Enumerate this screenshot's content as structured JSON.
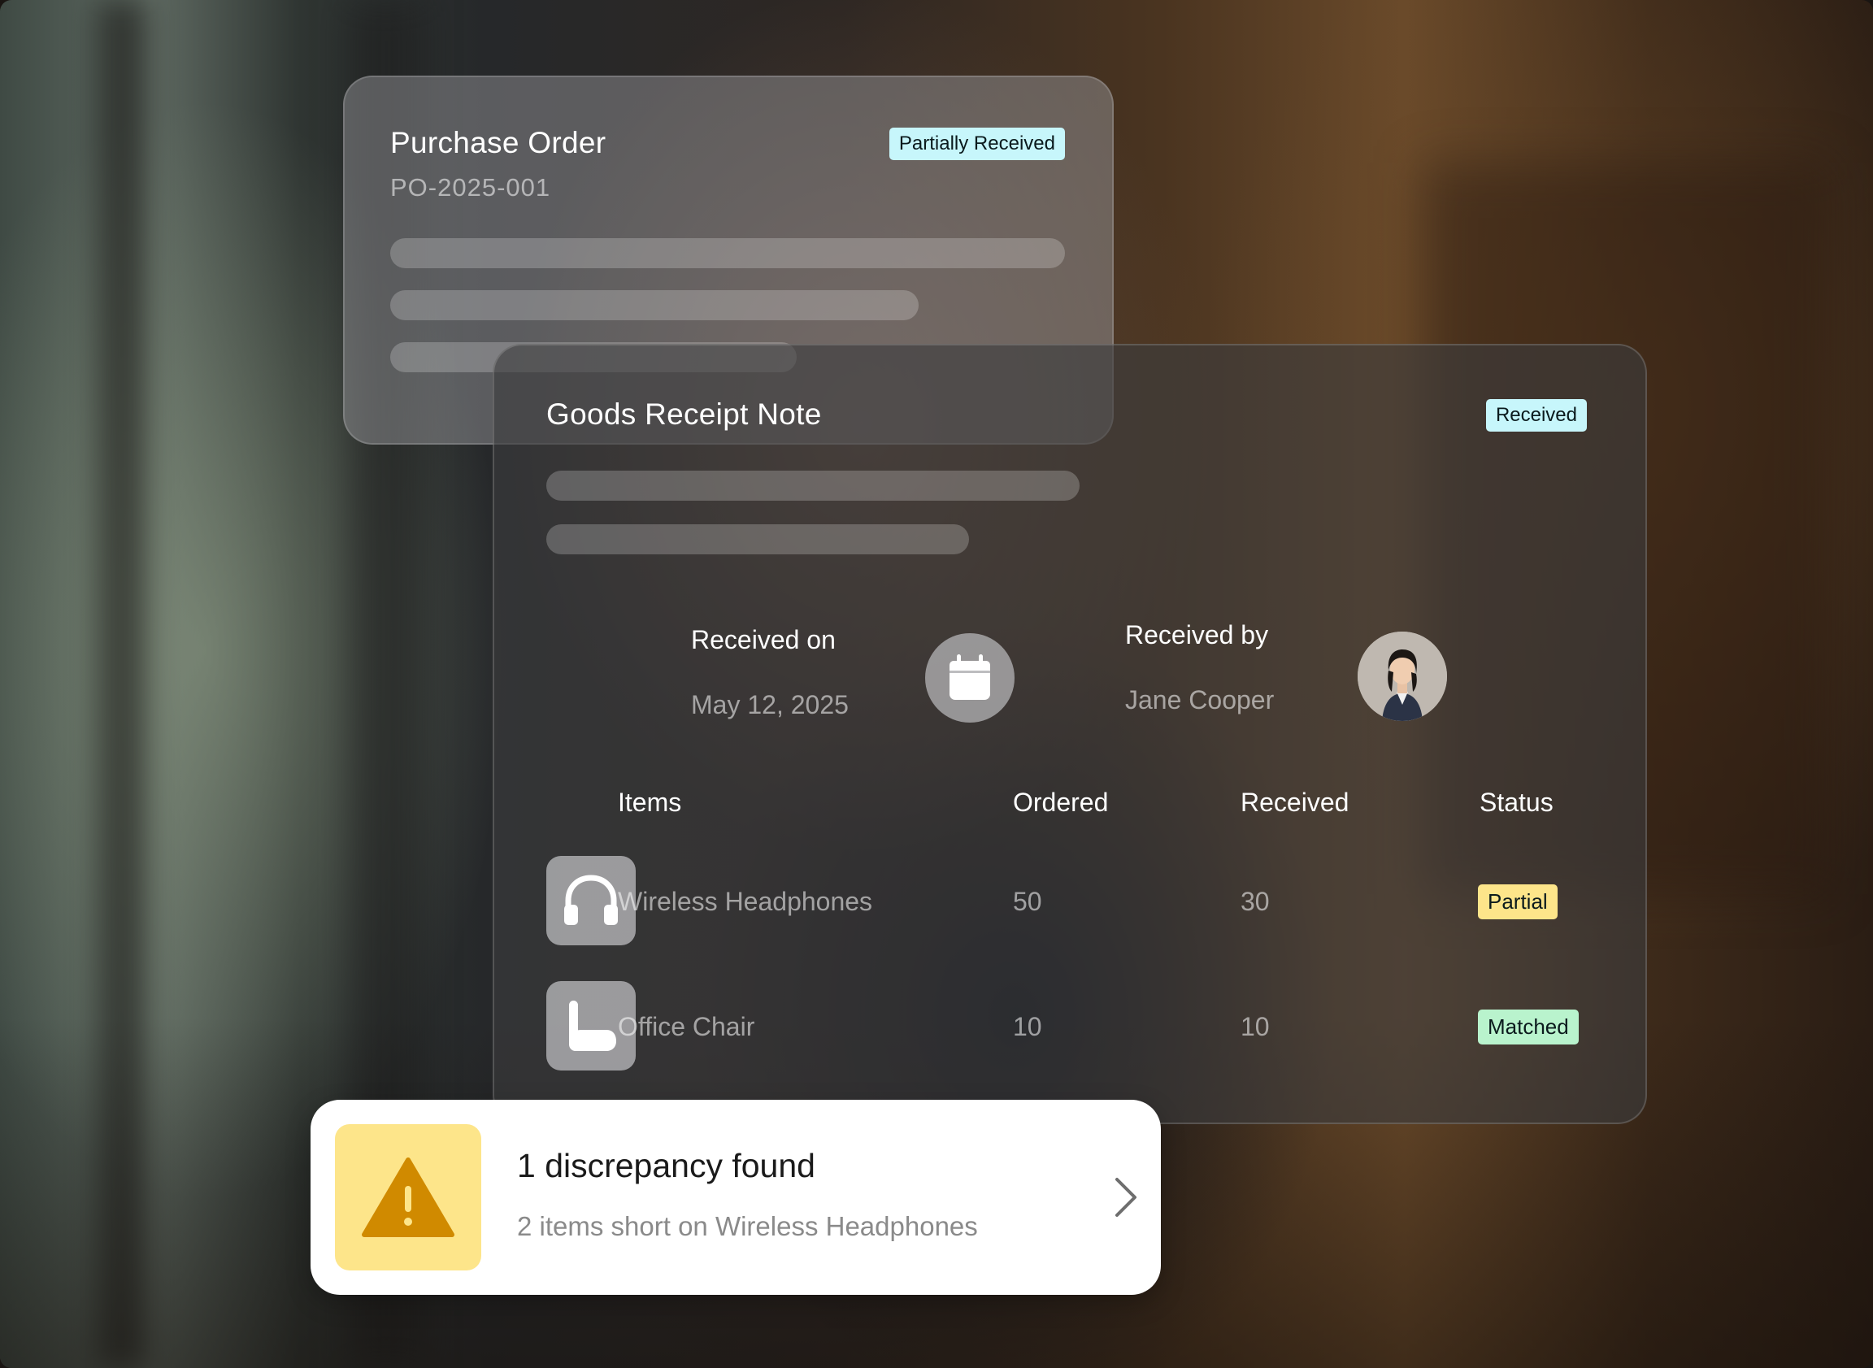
{
  "purchase_order": {
    "title": "Purchase Order",
    "number": "PO-2025-001",
    "status": "Partially Received"
  },
  "goods_receipt": {
    "title": "Goods Receipt Note",
    "status": "Received",
    "received_on_label": "Received on",
    "received_on_value": "May 12, 2025",
    "received_by_label": "Received by",
    "received_by_value": "Jane Cooper",
    "table": {
      "headers": [
        "Items",
        "Ordered",
        "Received",
        "Status"
      ],
      "rows": [
        {
          "icon": "headphones-icon",
          "item": "Wireless Headphones",
          "ordered": "50",
          "received": "30",
          "status": "Partial",
          "status_color": "#fde58a"
        },
        {
          "icon": "chair-icon",
          "item": "Office Chair",
          "ordered": "10",
          "received": "10",
          "status": "Matched",
          "status_color": "#b9f3cd"
        }
      ]
    }
  },
  "alert": {
    "icon": "warning-icon",
    "title": "1 discrepancy found",
    "subtitle": "2 items short on Wireless Headphones",
    "accent": "#fde58a",
    "icon_color": "#d08a00"
  },
  "colors": {
    "badge_cyan": "#c7f6fb",
    "badge_yellow": "#fde58a",
    "badge_green": "#b9f3cd"
  }
}
